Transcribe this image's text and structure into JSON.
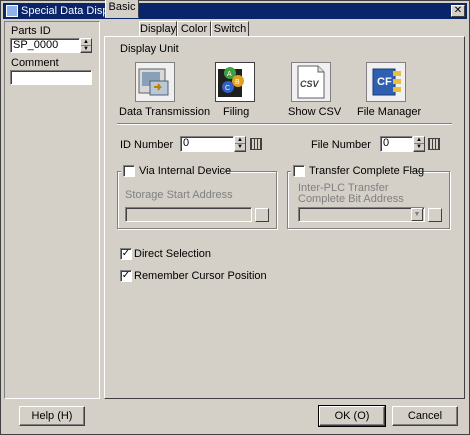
{
  "window": {
    "title": "Special Data Display"
  },
  "left": {
    "parts_id_label": "Parts ID",
    "parts_id_value": "SP_0000",
    "comment_label": "Comment",
    "comment_value": ""
  },
  "tabs": [
    {
      "label": "Basic",
      "active": true
    },
    {
      "label": "Display",
      "active": false
    },
    {
      "label": "Color",
      "active": false
    },
    {
      "label": "Switch",
      "active": false
    }
  ],
  "basic": {
    "display_unit_label": "Display Unit",
    "units": [
      {
        "label": "Data Transmission",
        "icon": "data-transmission-icon",
        "selected": false
      },
      {
        "label": "Filing",
        "icon": "filing-icon",
        "selected": true
      },
      {
        "label": "Show CSV",
        "icon": "show-csv-icon",
        "selected": false
      },
      {
        "label": "File Manager",
        "icon": "file-manager-icon",
        "selected": false
      }
    ],
    "csv_glyph_text": "CSV",
    "cf_glyph_text": "CF",
    "id_number_label": "ID Number",
    "id_number_value": "0",
    "file_number_label": "File Number",
    "file_number_value": "0",
    "via_internal_device_label": "Via Internal Device",
    "storage_start_address_label": "Storage Start Address",
    "transfer_complete_flag_label": "Transfer Complete Flag",
    "inter_plc_label_line1": "Inter-PLC Transfer",
    "inter_plc_label_line2": "Complete Bit Address",
    "direct_selection_label": "Direct Selection",
    "direct_selection_checked": true,
    "remember_cursor_label": "Remember Cursor Position",
    "remember_cursor_checked": true
  },
  "footer": {
    "help_label": "Help (H)",
    "ok_label": "OK (O)",
    "cancel_label": "Cancel"
  }
}
